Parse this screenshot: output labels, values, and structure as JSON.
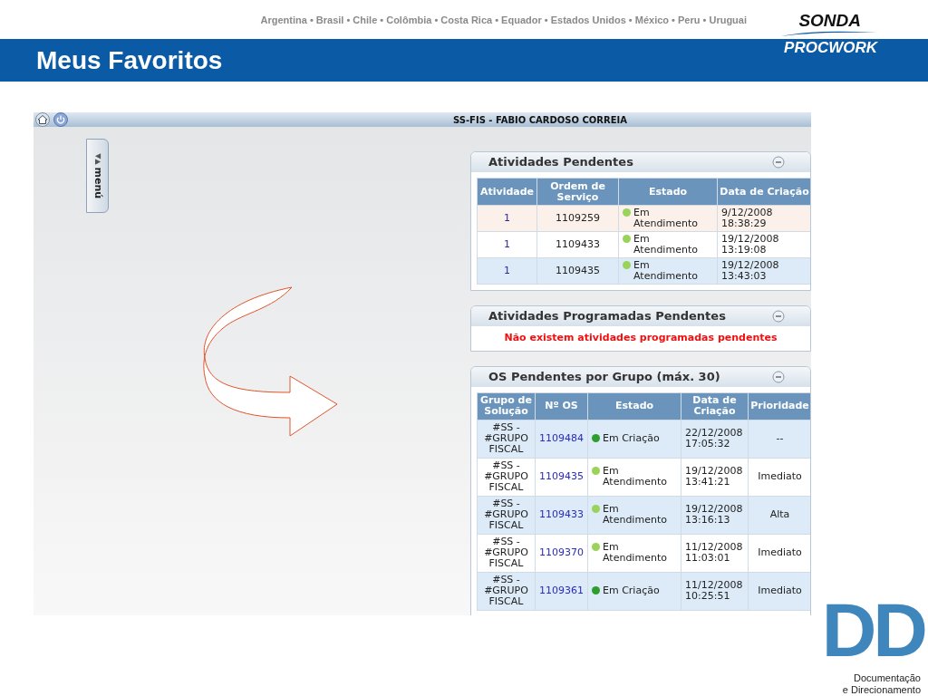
{
  "slide": {
    "countries": "Argentina • Brasil • Chile • Colômbia • Costa Rica • Equador • Estados Unidos • México • Peru • Uruguai",
    "brand_top": "SONDA",
    "brand_bottom": "PROCWORK",
    "title": "Meus Favoritos",
    "footer_logo_letters": "DD",
    "footer_logo_caption_1": "Documentação",
    "footer_logo_caption_2": "e Direcionamento"
  },
  "app": {
    "user": "SS-FIS - FABIO CARDOSO CORREIA",
    "menu_tab": "menú",
    "menu_arrows": "▼▲",
    "panels": [
      {
        "title": "Atividades Pendentes",
        "columns": [
          "Atividade",
          "Ordem de Serviço",
          "Estado",
          "Data de Criação"
        ],
        "rows": [
          {
            "highlighted": true,
            "cells": [
              "1",
              "1109259"
            ],
            "status": "Em Atendimento",
            "color": "#9ad35a",
            "date": "9/12/2008 18:38:29"
          },
          {
            "highlighted": false,
            "cells": [
              "1",
              "1109433"
            ],
            "status": "Em Atendimento",
            "color": "#9ad35a",
            "date": "19/12/2008 13:19:08"
          },
          {
            "highlighted": false,
            "cells": [
              "1",
              "1109435"
            ],
            "status": "Em Atendimento",
            "color": "#9ad35a",
            "date": "19/12/2008 13:43:03"
          }
        ]
      },
      {
        "title": "Atividades Programadas Pendentes",
        "message": "Não existem atividades programadas pendentes"
      },
      {
        "title": "OS Pendentes por Grupo (máx. 30)",
        "columns": [
          "Grupo de Solução",
          "Nº OS",
          "Estado",
          "Data de Criação",
          "Prioridade"
        ],
        "rows": [
          {
            "highlighted": false,
            "cells": [
              "#SS - #GRUPO FISCAL",
              "1109484"
            ],
            "status": "Em Criação",
            "color": "#2e9e2e",
            "date": "22/12/2008 17:05:32",
            "priority": "--"
          },
          {
            "highlighted": false,
            "cells": [
              "#SS - #GRUPO FISCAL",
              "1109435"
            ],
            "status": "Em Atendimento",
            "color": "#9ad35a",
            "date": "19/12/2008 13:41:21",
            "priority": "Imediato"
          },
          {
            "highlighted": false,
            "cells": [
              "#SS - #GRUPO FISCAL",
              "1109433"
            ],
            "status": "Em Atendimento",
            "color": "#9ad35a",
            "date": "19/12/2008 13:16:13",
            "priority": "Alta"
          },
          {
            "highlighted": false,
            "cells": [
              "#SS - #GRUPO FISCAL",
              "1109370"
            ],
            "status": "Em Atendimento",
            "color": "#9ad35a",
            "date": "11/12/2008 11:03:01",
            "priority": "Imediato"
          },
          {
            "highlighted": false,
            "cells": [
              "#SS - #GRUPO FISCAL",
              "1109361"
            ],
            "status": "Em Criação",
            "color": "#2e9e2e",
            "date": "11/12/2008 10:25:51",
            "priority": "Imediato"
          }
        ]
      }
    ]
  }
}
